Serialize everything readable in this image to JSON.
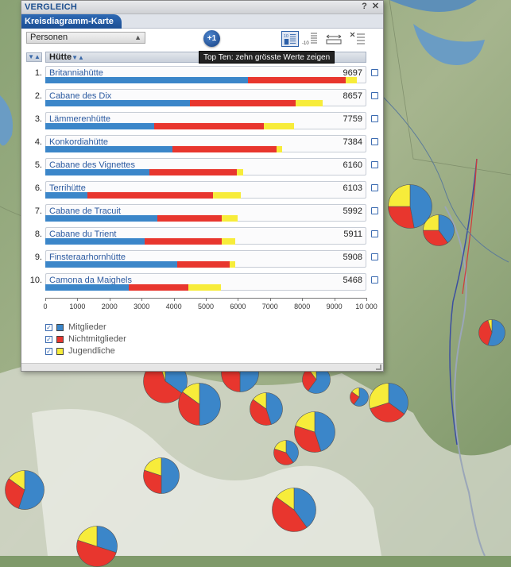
{
  "window": {
    "title": "VERGLEICH",
    "help_label": "?",
    "close_label": "✕",
    "tab_label": "Kreisdiagramm-Karte"
  },
  "toolbar": {
    "dropdown_value": "Personen",
    "add_label": "+1",
    "tooltip": "Top Ten: zehn grösste Werte zeigen",
    "icons": [
      "top10-icon",
      "bottom10-icon",
      "column-width-icon",
      "remove-list-icon"
    ]
  },
  "table": {
    "rank_sort_label": "▼▲",
    "column_label": "Hütte",
    "column_sort_label": "▼▲"
  },
  "colors": {
    "mitglieder": "#3b86c9",
    "nichtmitglieder": "#e8362e",
    "jugendliche": "#f7ec3a",
    "accent": "#1d4f8f"
  },
  "chart_data": {
    "type": "bar",
    "stacked": true,
    "orientation": "horizontal",
    "xlim": [
      0,
      10000
    ],
    "x_ticks": [
      "0",
      "1000",
      "2000",
      "3000",
      "4000",
      "5000",
      "6000",
      "7000",
      "8000",
      "9000",
      "10 000"
    ],
    "categories": [
      "Britanniahütte",
      "Cabane des Dix",
      "Lämmerenhütte",
      "Konkordiahütte",
      "Cabane des Vignettes",
      "Terrihütte",
      "Cabane de Tracuit",
      "Cabane du Trient",
      "Finsteraarhornhütte",
      "Camona da Maighels"
    ],
    "ranks": [
      "1.",
      "2.",
      "3.",
      "4.",
      "5.",
      "6.",
      "7.",
      "8.",
      "9.",
      "10."
    ],
    "totals": [
      "9697",
      "8657",
      "7759",
      "7384",
      "6160",
      "6103",
      "5992",
      "5911",
      "5908",
      "5468"
    ],
    "series": [
      {
        "name": "Mitglieder",
        "values": [
          6300,
          4500,
          3400,
          3950,
          3250,
          1320,
          3500,
          3100,
          4100,
          2600
        ]
      },
      {
        "name": "Nichtmitglieder",
        "values": [
          3050,
          3300,
          3400,
          3250,
          2720,
          3900,
          2000,
          2400,
          1650,
          1850
        ]
      },
      {
        "name": "Jugendliche",
        "values": [
          350,
          850,
          950,
          180,
          190,
          880,
          490,
          410,
          160,
          1010
        ]
      }
    ]
  },
  "legend": [
    {
      "label": "Mitglieder",
      "checked": "✓"
    },
    {
      "label": "Nichtmitglieder",
      "checked": "✓"
    },
    {
      "label": "Jugendliche",
      "checked": "✓"
    }
  ],
  "map_pies": [
    {
      "m": 0.47,
      "n": 0.28,
      "j": 0.25
    },
    {
      "m": 0.4,
      "n": 0.35,
      "j": 0.25
    },
    {
      "m": 0.55,
      "n": 0.4,
      "j": 0.05
    },
    {
      "m": 0.35,
      "n": 0.6,
      "j": 0.05
    },
    {
      "m": 0.5,
      "n": 0.35,
      "j": 0.15
    },
    {
      "m": 0.45,
      "n": 0.4,
      "j": 0.15
    },
    {
      "m": 0.6,
      "n": 0.3,
      "j": 0.1
    },
    {
      "m": 0.35,
      "n": 0.35,
      "j": 0.3
    },
    {
      "m": 0.45,
      "n": 0.35,
      "j": 0.2
    },
    {
      "m": 0.4,
      "n": 0.4,
      "j": 0.2
    },
    {
      "m": 0.5,
      "n": 0.3,
      "j": 0.2
    },
    {
      "m": 0.55,
      "n": 0.3,
      "j": 0.15
    },
    {
      "m": 0.4,
      "n": 0.45,
      "j": 0.15
    },
    {
      "m": 0.3,
      "n": 0.5,
      "j": 0.2
    },
    {
      "m": 0.5,
      "n": 0.4,
      "j": 0.1
    },
    {
      "m": 0.6,
      "n": 0.25,
      "j": 0.15
    }
  ]
}
